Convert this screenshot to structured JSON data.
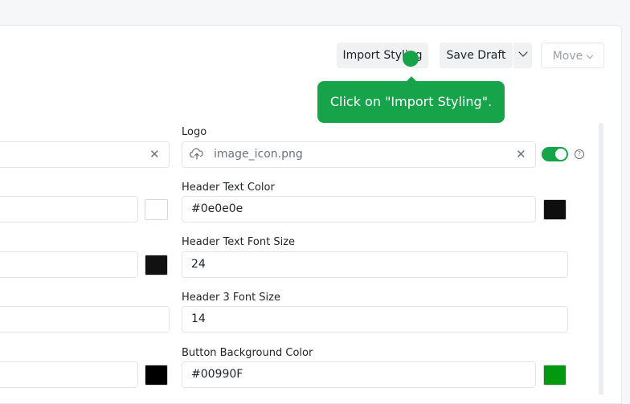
{
  "toolbar": {
    "import_label": "Import Styling",
    "save_label": "Save Draft",
    "move_label": "Move"
  },
  "tooltip": {
    "text": "Click on \"Import Styling\"."
  },
  "fields": {
    "logo": {
      "label": "Logo",
      "value": "image_icon.png",
      "enabled": true
    },
    "header_text_color": {
      "label": "Header Text Color",
      "value": "#0e0e0e",
      "swatch": "#0e0e0e"
    },
    "header_text_font_size": {
      "label": "Header Text Font Size",
      "value": "24"
    },
    "header3_font_size": {
      "label": "Header 3 Font Size",
      "value": "14"
    },
    "button_background_color": {
      "label": "Button Background Color",
      "value": "#00990F",
      "swatch": "#00990F"
    }
  },
  "left_column": {
    "swatches": [
      "#ffffff",
      "#111111",
      "#000000"
    ]
  },
  "colors": {
    "accent": "#16a34a"
  }
}
